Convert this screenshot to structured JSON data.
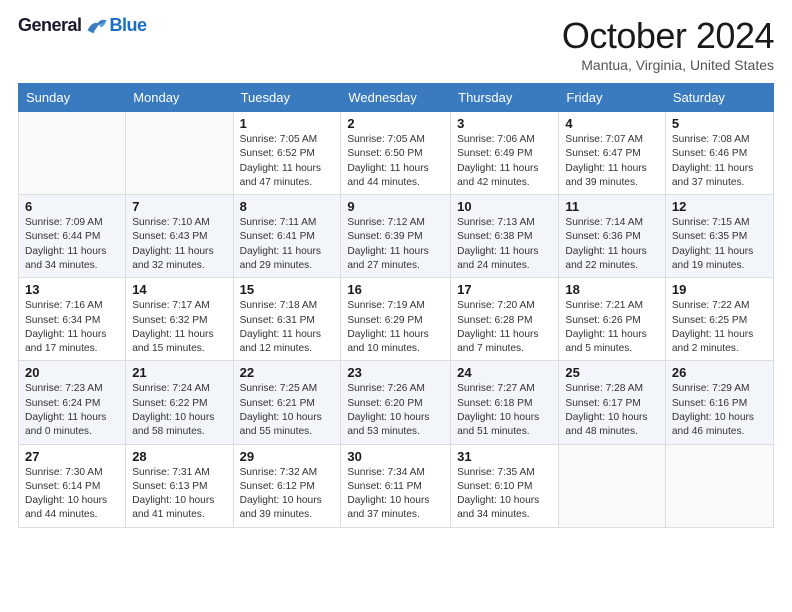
{
  "logo": {
    "general": "General",
    "blue": "Blue"
  },
  "title": "October 2024",
  "subtitle": "Mantua, Virginia, United States",
  "headers": [
    "Sunday",
    "Monday",
    "Tuesday",
    "Wednesday",
    "Thursday",
    "Friday",
    "Saturday"
  ],
  "weeks": [
    [
      {
        "day": "",
        "sunrise": "",
        "sunset": "",
        "daylight": ""
      },
      {
        "day": "",
        "sunrise": "",
        "sunset": "",
        "daylight": ""
      },
      {
        "day": "1",
        "sunrise": "Sunrise: 7:05 AM",
        "sunset": "Sunset: 6:52 PM",
        "daylight": "Daylight: 11 hours and 47 minutes."
      },
      {
        "day": "2",
        "sunrise": "Sunrise: 7:05 AM",
        "sunset": "Sunset: 6:50 PM",
        "daylight": "Daylight: 11 hours and 44 minutes."
      },
      {
        "day": "3",
        "sunrise": "Sunrise: 7:06 AM",
        "sunset": "Sunset: 6:49 PM",
        "daylight": "Daylight: 11 hours and 42 minutes."
      },
      {
        "day": "4",
        "sunrise": "Sunrise: 7:07 AM",
        "sunset": "Sunset: 6:47 PM",
        "daylight": "Daylight: 11 hours and 39 minutes."
      },
      {
        "day": "5",
        "sunrise": "Sunrise: 7:08 AM",
        "sunset": "Sunset: 6:46 PM",
        "daylight": "Daylight: 11 hours and 37 minutes."
      }
    ],
    [
      {
        "day": "6",
        "sunrise": "Sunrise: 7:09 AM",
        "sunset": "Sunset: 6:44 PM",
        "daylight": "Daylight: 11 hours and 34 minutes."
      },
      {
        "day": "7",
        "sunrise": "Sunrise: 7:10 AM",
        "sunset": "Sunset: 6:43 PM",
        "daylight": "Daylight: 11 hours and 32 minutes."
      },
      {
        "day": "8",
        "sunrise": "Sunrise: 7:11 AM",
        "sunset": "Sunset: 6:41 PM",
        "daylight": "Daylight: 11 hours and 29 minutes."
      },
      {
        "day": "9",
        "sunrise": "Sunrise: 7:12 AM",
        "sunset": "Sunset: 6:39 PM",
        "daylight": "Daylight: 11 hours and 27 minutes."
      },
      {
        "day": "10",
        "sunrise": "Sunrise: 7:13 AM",
        "sunset": "Sunset: 6:38 PM",
        "daylight": "Daylight: 11 hours and 24 minutes."
      },
      {
        "day": "11",
        "sunrise": "Sunrise: 7:14 AM",
        "sunset": "Sunset: 6:36 PM",
        "daylight": "Daylight: 11 hours and 22 minutes."
      },
      {
        "day": "12",
        "sunrise": "Sunrise: 7:15 AM",
        "sunset": "Sunset: 6:35 PM",
        "daylight": "Daylight: 11 hours and 19 minutes."
      }
    ],
    [
      {
        "day": "13",
        "sunrise": "Sunrise: 7:16 AM",
        "sunset": "Sunset: 6:34 PM",
        "daylight": "Daylight: 11 hours and 17 minutes."
      },
      {
        "day": "14",
        "sunrise": "Sunrise: 7:17 AM",
        "sunset": "Sunset: 6:32 PM",
        "daylight": "Daylight: 11 hours and 15 minutes."
      },
      {
        "day": "15",
        "sunrise": "Sunrise: 7:18 AM",
        "sunset": "Sunset: 6:31 PM",
        "daylight": "Daylight: 11 hours and 12 minutes."
      },
      {
        "day": "16",
        "sunrise": "Sunrise: 7:19 AM",
        "sunset": "Sunset: 6:29 PM",
        "daylight": "Daylight: 11 hours and 10 minutes."
      },
      {
        "day": "17",
        "sunrise": "Sunrise: 7:20 AM",
        "sunset": "Sunset: 6:28 PM",
        "daylight": "Daylight: 11 hours and 7 minutes."
      },
      {
        "day": "18",
        "sunrise": "Sunrise: 7:21 AM",
        "sunset": "Sunset: 6:26 PM",
        "daylight": "Daylight: 11 hours and 5 minutes."
      },
      {
        "day": "19",
        "sunrise": "Sunrise: 7:22 AM",
        "sunset": "Sunset: 6:25 PM",
        "daylight": "Daylight: 11 hours and 2 minutes."
      }
    ],
    [
      {
        "day": "20",
        "sunrise": "Sunrise: 7:23 AM",
        "sunset": "Sunset: 6:24 PM",
        "daylight": "Daylight: 11 hours and 0 minutes."
      },
      {
        "day": "21",
        "sunrise": "Sunrise: 7:24 AM",
        "sunset": "Sunset: 6:22 PM",
        "daylight": "Daylight: 10 hours and 58 minutes."
      },
      {
        "day": "22",
        "sunrise": "Sunrise: 7:25 AM",
        "sunset": "Sunset: 6:21 PM",
        "daylight": "Daylight: 10 hours and 55 minutes."
      },
      {
        "day": "23",
        "sunrise": "Sunrise: 7:26 AM",
        "sunset": "Sunset: 6:20 PM",
        "daylight": "Daylight: 10 hours and 53 minutes."
      },
      {
        "day": "24",
        "sunrise": "Sunrise: 7:27 AM",
        "sunset": "Sunset: 6:18 PM",
        "daylight": "Daylight: 10 hours and 51 minutes."
      },
      {
        "day": "25",
        "sunrise": "Sunrise: 7:28 AM",
        "sunset": "Sunset: 6:17 PM",
        "daylight": "Daylight: 10 hours and 48 minutes."
      },
      {
        "day": "26",
        "sunrise": "Sunrise: 7:29 AM",
        "sunset": "Sunset: 6:16 PM",
        "daylight": "Daylight: 10 hours and 46 minutes."
      }
    ],
    [
      {
        "day": "27",
        "sunrise": "Sunrise: 7:30 AM",
        "sunset": "Sunset: 6:14 PM",
        "daylight": "Daylight: 10 hours and 44 minutes."
      },
      {
        "day": "28",
        "sunrise": "Sunrise: 7:31 AM",
        "sunset": "Sunset: 6:13 PM",
        "daylight": "Daylight: 10 hours and 41 minutes."
      },
      {
        "day": "29",
        "sunrise": "Sunrise: 7:32 AM",
        "sunset": "Sunset: 6:12 PM",
        "daylight": "Daylight: 10 hours and 39 minutes."
      },
      {
        "day": "30",
        "sunrise": "Sunrise: 7:34 AM",
        "sunset": "Sunset: 6:11 PM",
        "daylight": "Daylight: 10 hours and 37 minutes."
      },
      {
        "day": "31",
        "sunrise": "Sunrise: 7:35 AM",
        "sunset": "Sunset: 6:10 PM",
        "daylight": "Daylight: 10 hours and 34 minutes."
      },
      {
        "day": "",
        "sunrise": "",
        "sunset": "",
        "daylight": ""
      },
      {
        "day": "",
        "sunrise": "",
        "sunset": "",
        "daylight": ""
      }
    ]
  ]
}
